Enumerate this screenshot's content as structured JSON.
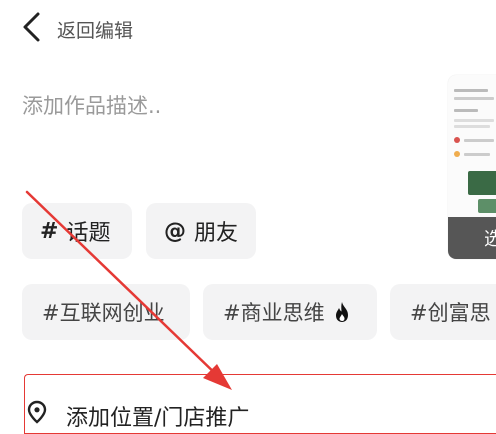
{
  "header": {
    "back_label": "返回编辑"
  },
  "description": {
    "placeholder": "添加作品描述.."
  },
  "thumbnail": {
    "overlay_text": "选"
  },
  "chips": {
    "topic": {
      "symbol": "#",
      "label": "话题"
    },
    "friend": {
      "symbol": "@",
      "label": "朋友"
    }
  },
  "hashtags": [
    {
      "label": "#互联网创业"
    },
    {
      "label": "#商业思维",
      "icon": "flame-icon"
    },
    {
      "label": "#创富思"
    }
  ],
  "location": {
    "label": "添加位置/门店推广",
    "icon": "location-pin-icon"
  },
  "colors": {
    "annotation_red": "#e53935",
    "chip_bg": "#f3f3f4",
    "thumbnail_accent": "#3a6a45"
  }
}
